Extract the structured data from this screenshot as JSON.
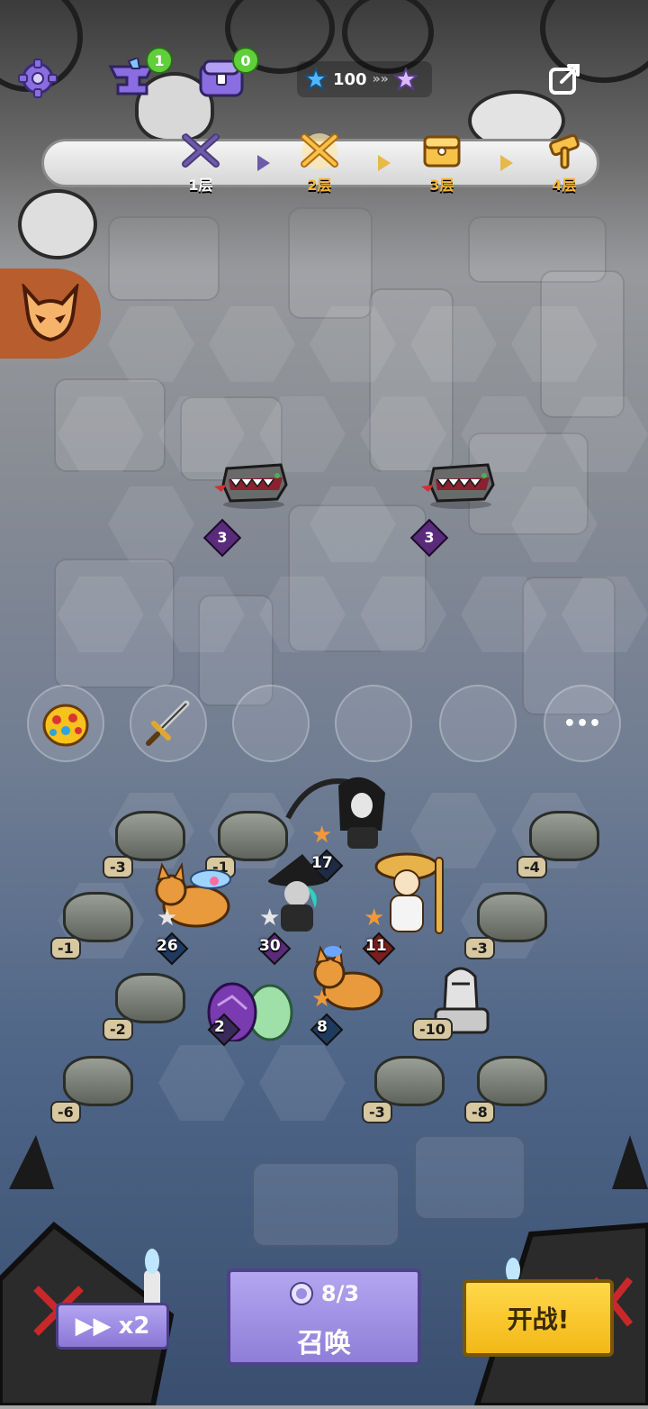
{
  "topbar": {
    "anvil_count": "1",
    "chest_count": "0",
    "star_count": "100"
  },
  "floors": [
    {
      "label": "1层",
      "state": "done"
    },
    {
      "label": "2层",
      "state": "current"
    },
    {
      "label": "3层",
      "state": "chest"
    },
    {
      "label": "4层",
      "state": "locked"
    }
  ],
  "enemies": [
    {
      "name": "mimic-jaw",
      "level": "3"
    },
    {
      "name": "mimic-jaw",
      "level": "3"
    }
  ],
  "item_slots": [
    "crown",
    "sword",
    "",
    "",
    "",
    "more"
  ],
  "more_label": "•••",
  "rocks": [
    "-3",
    "-1",
    "-4",
    "-1",
    "-3",
    "-2",
    "-10",
    "-6",
    "-3",
    "-8"
  ],
  "units": [
    {
      "name": "grim-reaper",
      "value": "17"
    },
    {
      "name": "corgi-mage",
      "value": "26"
    },
    {
      "name": "witch",
      "value": "30"
    },
    {
      "name": "mushroom-monk",
      "value": "11"
    },
    {
      "name": "corgi",
      "value": "8"
    },
    {
      "name": "egg",
      "value": "2"
    }
  ],
  "bottom": {
    "speed_label": "x2",
    "summon_count": "8/3",
    "summon_label": "召唤",
    "start_label": "开战!"
  },
  "colors": {
    "summon_bg": "#9b8be0",
    "start_bg": "#f6c21c",
    "accent_gold": "#e7b84a"
  }
}
